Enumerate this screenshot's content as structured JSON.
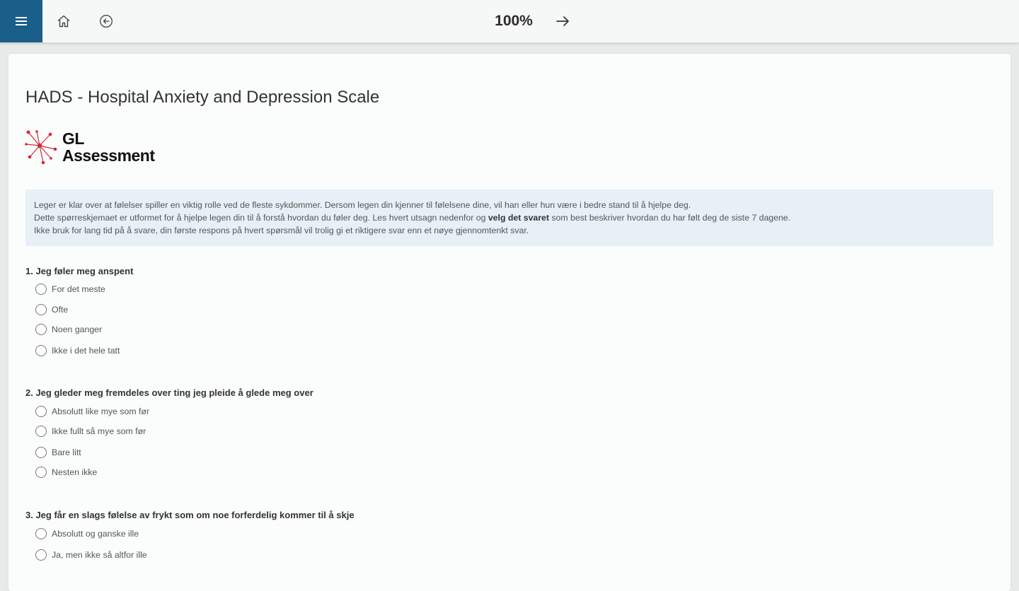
{
  "header": {
    "progress": "100%",
    "icons": {
      "menu": "hamburger-menu-icon",
      "home": "home-icon",
      "back": "back-arrow-icon",
      "next": "forward-arrow-icon"
    },
    "colors": {
      "menu_bg": "#1a5f8a",
      "bar_bg": "#f6f7f7"
    }
  },
  "main": {
    "title": "HADS - Hospital Anxiety and Depression Scale",
    "logo": {
      "line1": "GL",
      "line2": "Assessment",
      "accent": "#d42a36"
    },
    "intro": {
      "line1": "Leger er klar over at følelser spiller en viktig rolle ved de fleste sykdommer. Dersom legen din kjenner til følelsene dine, vil han eller hun være i bedre stand til å hjelpe deg.",
      "line2_a": "Dette spørreskjemaet er utformet for å hjelpe legen din til å forstå hvordan du føler deg. Les hvert utsagn nedenfor og ",
      "line2_bold": "velg det svaret",
      "line2_b": " som best beskriver hvordan du har følt deg de siste 7 dagene.",
      "line3": "Ikke bruk for lang tid på å svare, din første respons på hvert spørsmål vil trolig gi et riktigere svar enn et nøye gjennomtenkt svar."
    },
    "questions": [
      {
        "label": "1. Jeg føler meg anspent",
        "options": [
          "For det meste",
          "Ofte",
          "Noen ganger",
          "Ikke i det hele tatt"
        ]
      },
      {
        "label": "2. Jeg gleder meg fremdeles over ting jeg pleide å glede meg over",
        "options": [
          "Absolutt like mye som før",
          "Ikke fullt så mye som før",
          "Bare litt",
          "Nesten ikke"
        ]
      },
      {
        "label": "3. Jeg får en slags følelse av frykt som om noe forferdelig kommer til å skje",
        "options": [
          "Absolutt og ganske ille",
          "Ja, men ikke så altfor ille"
        ]
      }
    ]
  }
}
